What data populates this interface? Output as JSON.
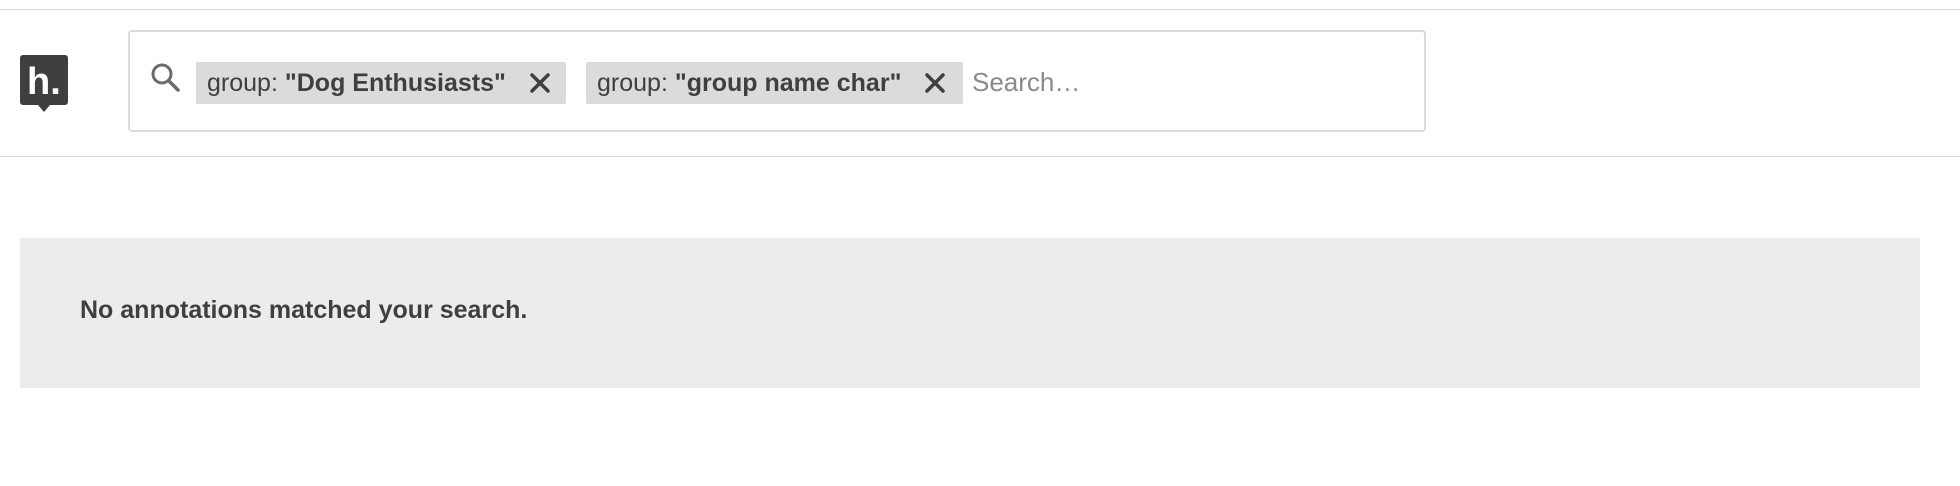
{
  "search": {
    "placeholder": "Search…",
    "value": "",
    "filters": [
      {
        "key": "group:",
        "value": "\"Dog Enthusiasts\"",
        "remove_icon": "close-icon"
      },
      {
        "key": "group:",
        "value": "\"group name char\"",
        "remove_icon": "close-icon"
      }
    ]
  },
  "logo": {
    "text": "h.",
    "icon": "hypothesis-logo-icon"
  },
  "results": {
    "empty_message": "No annotations matched your search."
  },
  "colors": {
    "chip_background": "#dbdbdb",
    "panel_background": "#ececec",
    "text": "#3f3f3f",
    "logo": "#3f3f3f"
  }
}
